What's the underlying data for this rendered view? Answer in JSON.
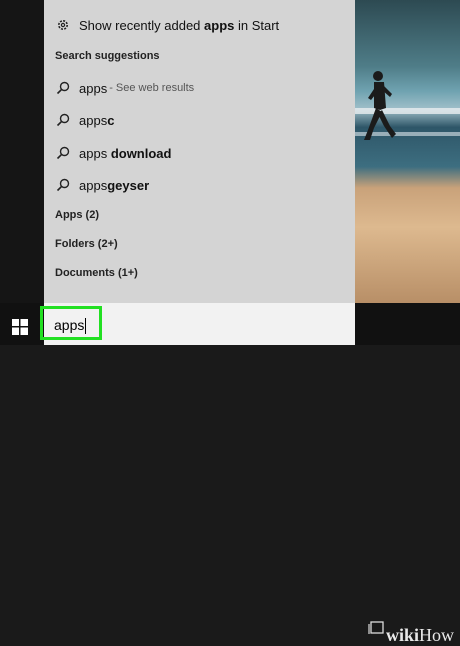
{
  "settings_item": {
    "prefix": "Show recently added ",
    "bold": "apps",
    "suffix": " in Start",
    "icon": "gear-icon"
  },
  "sections": {
    "search_suggestions": "Search suggestions",
    "apps": "Apps (2)",
    "folders": "Folders (2+)",
    "documents": "Documents (1+)"
  },
  "suggestions": [
    {
      "plain": "apps",
      "bold": "",
      "note": " - See web results",
      "icon": "search-icon"
    },
    {
      "plain": "apps",
      "bold": "c",
      "note": "",
      "icon": "search-icon"
    },
    {
      "plain": "apps ",
      "bold": "download",
      "note": "",
      "icon": "search-icon"
    },
    {
      "plain": "apps",
      "bold": "geyser",
      "note": "",
      "icon": "search-icon"
    }
  ],
  "search": {
    "value": "apps"
  },
  "watermark": {
    "wiki": "wiki",
    "how": "How"
  },
  "colors": {
    "panel": "#d4d4d4",
    "highlight": "#22e022",
    "taskbar": "#111111"
  }
}
